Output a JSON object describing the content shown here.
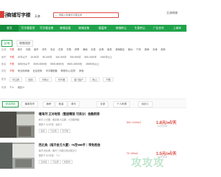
{
  "header": {
    "logo_glyph": "客",
    "site_name": "商铺写字楼",
    "city": "天津 ·",
    "search_placeholder": "请输入商铺写字楼名称",
    "right_text": "天津商铺"
  },
  "nav": {
    "items": [
      "首页",
      "写字楼租赁",
      "写字楼出售",
      "商铺出租",
      "商铺出售",
      "楼盘库",
      "商铺转让",
      "生意转让",
      "广告合作",
      "上城市"
    ]
  },
  "filters": {
    "tabs": [
      "区域",
      "地铁找房"
    ],
    "district": {
      "label": "区域",
      "options": [
        "不限",
        "和平",
        "河西",
        "南开",
        "河东",
        "河北",
        "红桥",
        "东丽",
        "西青",
        "津南",
        "北辰",
        "武清",
        "宝坻",
        "滨海新区",
        "蓟州",
        "宁河",
        "静海",
        "天津",
        "其他"
      ]
    },
    "area": {
      "label": "面积",
      "options": [
        "不限",
        "20平以下",
        "20-50平",
        "50-100平",
        "100-200平",
        "200-500平",
        "500-1000平",
        "1000平以上"
      ]
    },
    "price": {
      "label": "租金",
      "options": [
        "不限",
        "3000元以下",
        "3000-5000元",
        "5000-8000元",
        "8000-15000元",
        "15000元以上"
      ]
    },
    "type": {
      "label": "类型",
      "options": [
        "不限",
        "商业街商铺",
        "社区底商",
        "写字楼配套",
        "购物中心/百货",
        "其他"
      ]
    },
    "more": {
      "label": "更多",
      "options": [
        "可注册",
        "临街",
        "可明火",
        "可外摆",
        "独门独户",
        "转让",
        "不限"
      ]
    },
    "source": {
      "label": "来源",
      "options": [
        "个人",
        "经纪人"
      ]
    }
  },
  "sort": {
    "items": [
      "综合排序",
      "最新发布",
      "面积",
      "租金",
      "单价",
      "全部",
      "个人房源",
      "经纪人"
    ],
    "active_index": 0
  },
  "listings": [
    {
      "title": "塘海河 正对地铁（整层精装 可拆分）金融街旁",
      "sub1": "和平-小白楼 · 南京路 大沽路 · 小白楼商圈",
      "sub2": "更新于 3小时前 · 经纪人",
      "tags": [
        "临街",
        "可注册",
        "写字楼"
      ],
      "area": "300~1000㎡",
      "price": "1.8元/㎡/天",
      "price_sub": "5.4万元/月"
    },
    {
      "title": "西北角（南开金方大厦）75至999平｜带免租金",
      "sub1": "南开-西北角 · 南开三马路与西北角交口",
      "sub2": "更新于 5小时前 · 个人",
      "tags": [
        "近地铁",
        "可注册",
        "精装修"
      ],
      "area": "75~999㎡",
      "price": "1.5元/㎡/天",
      "price_sub": "3.4万元/月"
    }
  ],
  "watermark": "攻攻攻",
  "colors": {
    "accent_green": "#1fa34a",
    "accent_red": "#d8413a"
  }
}
